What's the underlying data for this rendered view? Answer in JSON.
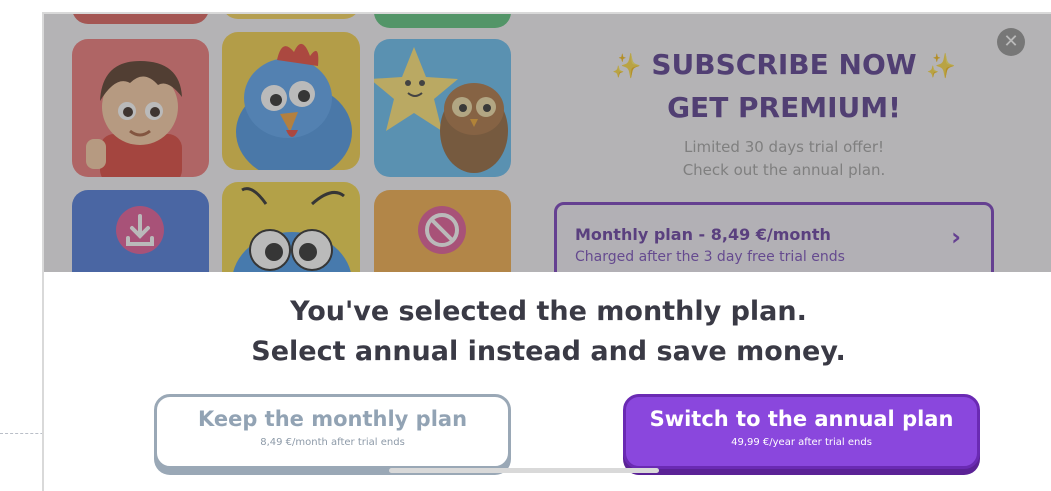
{
  "paywall": {
    "headline_line1": "SUBSCRIBE NOW",
    "headline_line2": "GET PREMIUM!",
    "sparkle": "✨",
    "offer_line1": "Limited 30 days trial offer!",
    "offer_line2": "Check out the annual plan.",
    "monthly_plan": {
      "title": "Monthly plan - 8,49 €/month",
      "note": "Charged after the 3 day free trial ends"
    },
    "close_glyph": "✕",
    "chevron_glyph": "›",
    "thumbnails": [
      "boy-character-thumbnail",
      "blue-chicken-thumbnail",
      "star-and-owl-thumbnail",
      "download-thumbnail",
      "bug-character-thumbnail",
      "no-ads-thumbnail"
    ]
  },
  "sheet": {
    "line1": "You've selected the monthly plan.",
    "line2": "Select annual instead and save money.",
    "keep_button": {
      "label": "Keep the monthly plan",
      "subtext": "8,49 €/month after trial ends"
    },
    "switch_button": {
      "label": "Switch to the annual plan",
      "subtext": "49,99 €/year after trial ends"
    }
  },
  "colors": {
    "brand_purple": "#8a47dd",
    "headline_purple": "#4b2c86",
    "keep_border": "#9aa8b6",
    "sparkle": "#f2c530"
  }
}
